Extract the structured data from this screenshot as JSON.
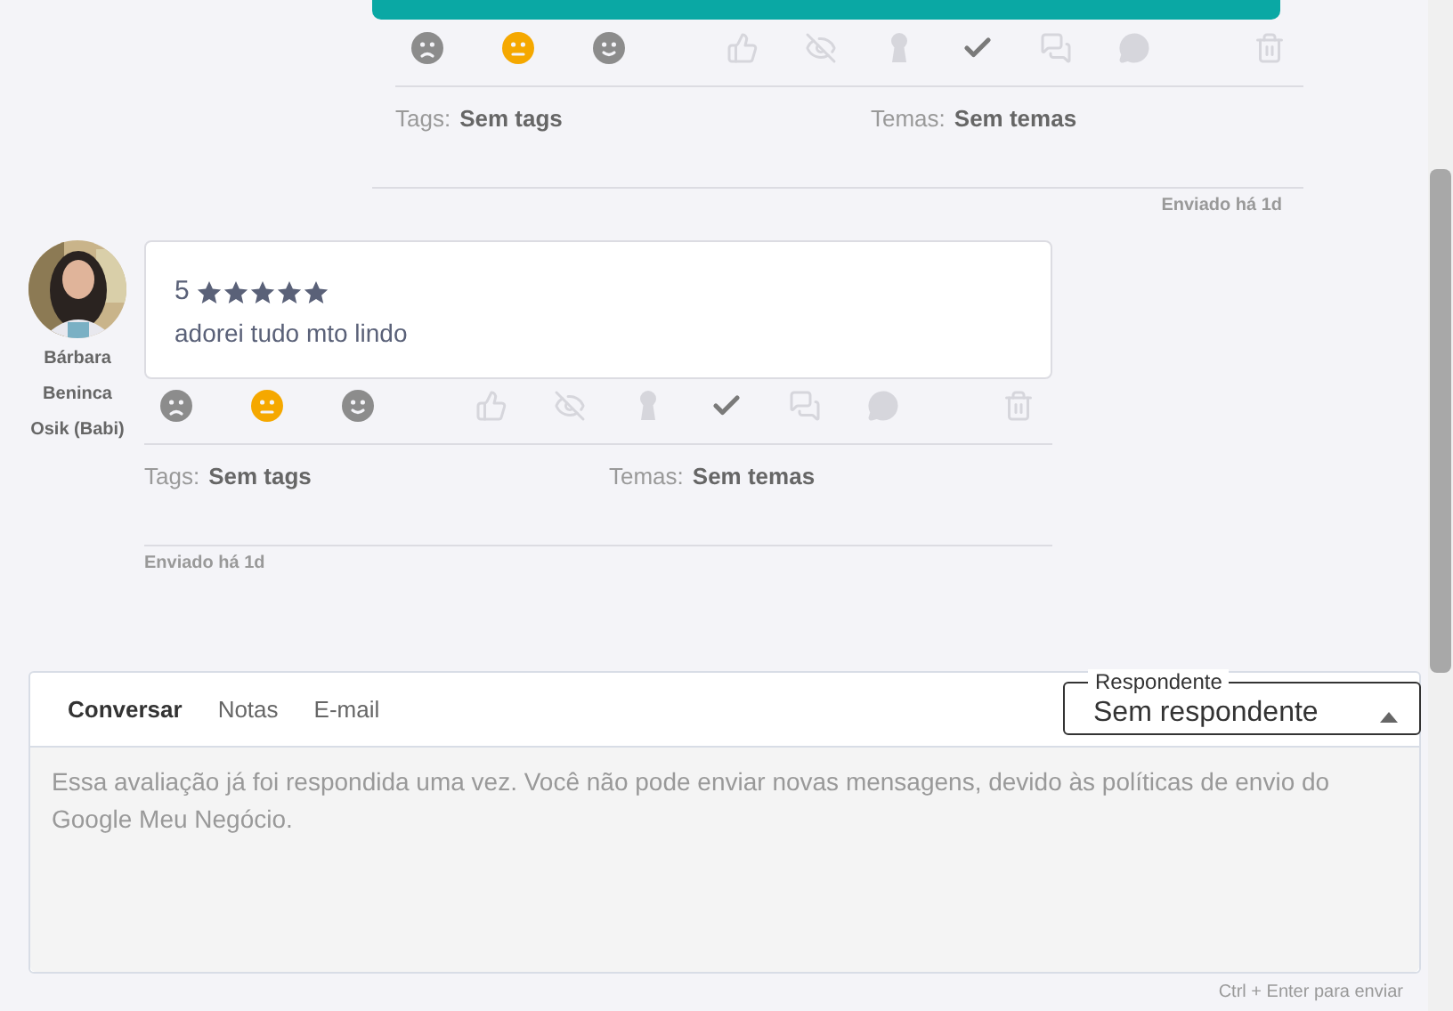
{
  "messages": [
    {
      "kind": "own",
      "sentiments": [
        {
          "kind": "sad",
          "selected": false
        },
        {
          "kind": "neutral",
          "selected": true
        },
        {
          "kind": "happy",
          "selected": false
        }
      ],
      "actions": [
        {
          "kind": "like",
          "active": false
        },
        {
          "kind": "hide",
          "active": false
        },
        {
          "kind": "private",
          "active": false
        },
        {
          "kind": "resolved",
          "active": true
        },
        {
          "kind": "chat",
          "active": false
        },
        {
          "kind": "messenger",
          "active": false
        },
        {
          "kind": "delete",
          "active": false
        }
      ],
      "tags_label": "Tags:",
      "tags": "Sem tags",
      "themes_label": "Temas:",
      "themes": "Sem temas",
      "sent": "Enviado há 1d"
    },
    {
      "kind": "customer",
      "author": "Bárbara Beninca Osik (Babi)",
      "rating": "5",
      "stars": 5,
      "text": "adorei tudo mto lindo",
      "sentiments": [
        {
          "kind": "sad",
          "selected": false
        },
        {
          "kind": "neutral",
          "selected": true
        },
        {
          "kind": "happy",
          "selected": false
        }
      ],
      "actions": [
        {
          "kind": "like",
          "active": false
        },
        {
          "kind": "hide",
          "active": false
        },
        {
          "kind": "private",
          "active": false
        },
        {
          "kind": "resolved",
          "active": true
        },
        {
          "kind": "chat",
          "active": false
        },
        {
          "kind": "messenger",
          "active": false
        },
        {
          "kind": "delete",
          "active": false
        }
      ],
      "tags_label": "Tags:",
      "tags": "Sem tags",
      "themes_label": "Temas:",
      "themes": "Sem temas",
      "sent": "Enviado há 1d"
    }
  ],
  "composer": {
    "tabs": [
      {
        "label": "Conversar",
        "selected": true
      },
      {
        "label": "Notas",
        "selected": false
      },
      {
        "label": "E-mail",
        "selected": false
      }
    ],
    "respondent": {
      "label": "Respondente",
      "value": "Sem respondente"
    },
    "message_field": {
      "disabled": true,
      "text": "Essa avaliação já foi respondida uma vez. Você não pode enviar novas mensagens, devido às políticas de envio do Google Meu Negócio."
    },
    "hint": "Ctrl + Enter para enviar"
  }
}
